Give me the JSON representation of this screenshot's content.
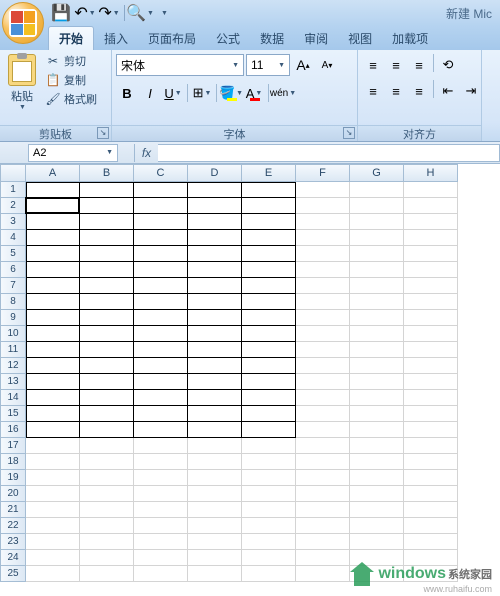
{
  "title": "新建 Mic",
  "tabs": [
    "开始",
    "插入",
    "页面布局",
    "公式",
    "数据",
    "审阅",
    "视图",
    "加载项"
  ],
  "active_tab": 0,
  "ribbon": {
    "clipboard": {
      "label": "剪贴板",
      "paste": "粘贴",
      "cut": "剪切",
      "copy": "复制",
      "format_painter": "格式刷"
    },
    "font": {
      "label": "字体",
      "name": "宋体",
      "size": "11"
    },
    "alignment": {
      "label": "对齐方"
    }
  },
  "formula_bar": {
    "cell_ref": "A2",
    "fx": "fx",
    "value": ""
  },
  "grid": {
    "cols": [
      "A",
      "B",
      "C",
      "D",
      "E",
      "F",
      "G",
      "H"
    ],
    "rows": 25,
    "bordered_range": {
      "r1": 1,
      "r2": 16,
      "c1": 0,
      "c2": 5
    },
    "active": {
      "row": 2,
      "col": 0
    }
  },
  "watermark": {
    "brand_green": "windows",
    "brand_grey": "系统家园",
    "url": "www.ruhaifu.com"
  }
}
